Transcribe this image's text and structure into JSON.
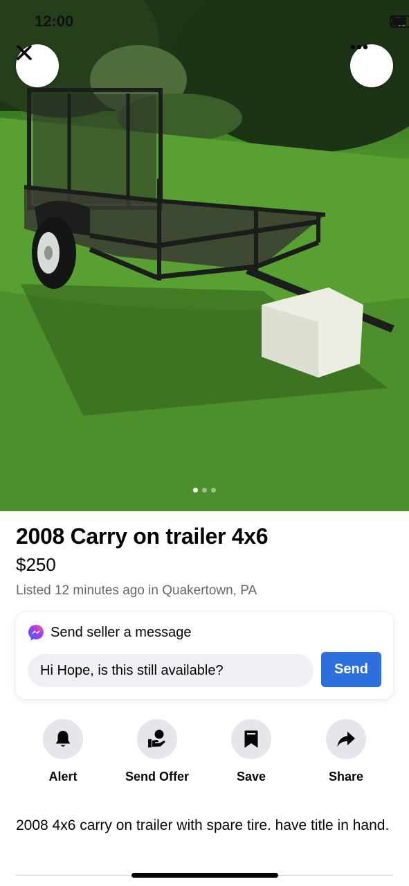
{
  "status_bar": {
    "time": "12:00"
  },
  "photo": {
    "description_alt": "",
    "page_count": 3,
    "current_page": 1
  },
  "listing": {
    "title": "2008 Carry on trailer 4x6",
    "price": "$250",
    "meta": "Listed 12 minutes ago in Quakertown, PA",
    "description": "2008 4x6 carry on trailer with spare tire. have title in hand."
  },
  "message_card": {
    "heading": "Send seller a message",
    "input_value": "Hi Hope, is this still available?",
    "send_label": "Send"
  },
  "actions": [
    {
      "label": "Alert",
      "icon": "bell-icon"
    },
    {
      "label": "Send Offer",
      "icon": "offer-hand-icon"
    },
    {
      "label": "Save",
      "icon": "bookmark-icon"
    },
    {
      "label": "Share",
      "icon": "share-arrow-icon"
    }
  ],
  "colors": {
    "accent": "#2d6fdc",
    "muted_text": "#65676b",
    "action_circle": "#e4e6eb"
  }
}
